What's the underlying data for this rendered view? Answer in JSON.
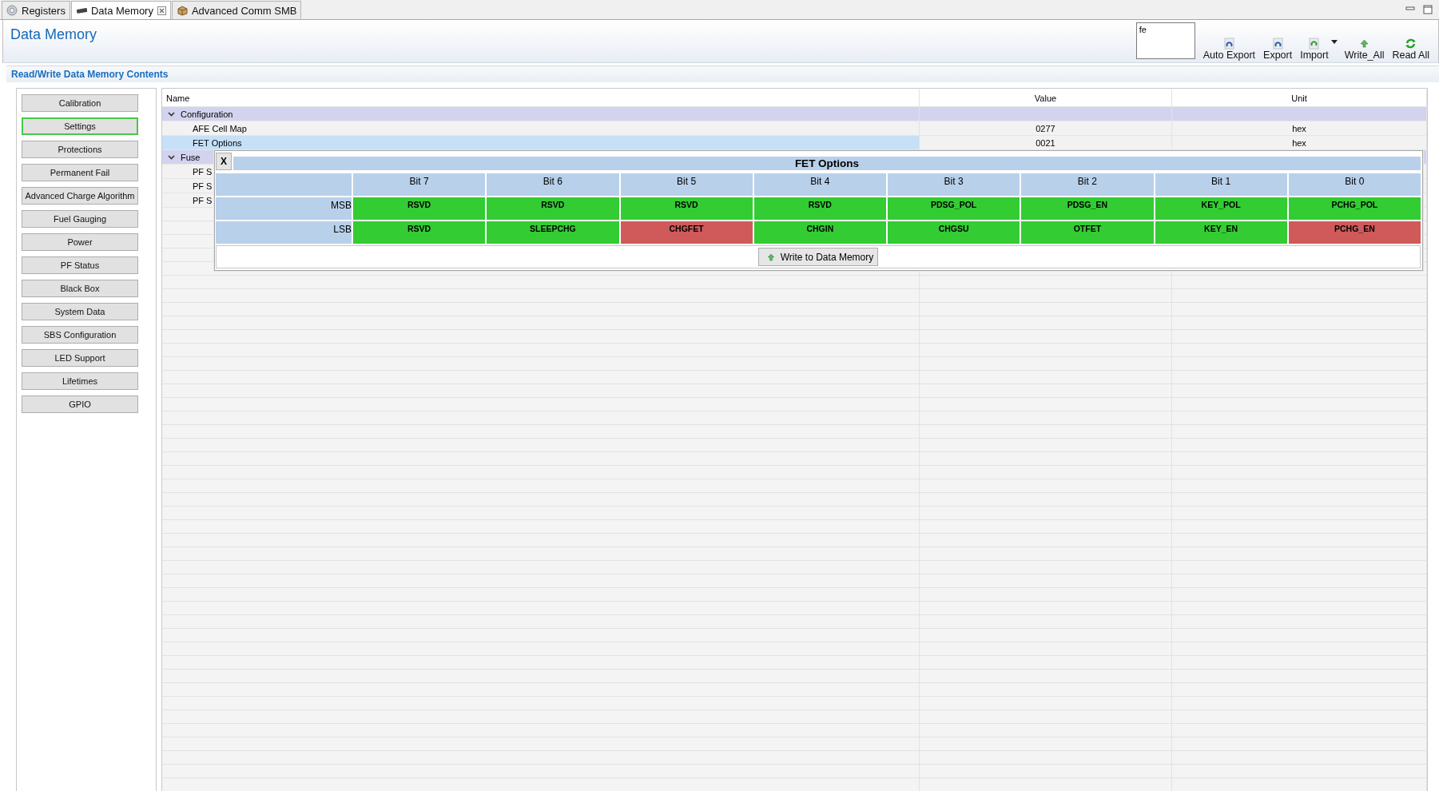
{
  "tabs": [
    {
      "label": "Registers",
      "selected": false
    },
    {
      "label": "Data Memory",
      "selected": true
    },
    {
      "label": "Advanced Comm SMB",
      "selected": false
    }
  ],
  "header": {
    "title": "Data Memory",
    "search": {
      "value": "fe"
    },
    "toolbar": [
      {
        "label": "Auto Export",
        "kind": "doc"
      },
      {
        "label": "Export",
        "kind": "doc"
      },
      {
        "label": "Import",
        "kind": "import"
      },
      {
        "label": "Write_All",
        "kind": "up"
      },
      {
        "label": "Read All",
        "kind": "refresh"
      }
    ]
  },
  "section_title": "Read/Write Data Memory Contents",
  "sidebar": {
    "items": [
      {
        "label": "Calibration",
        "selected": false
      },
      {
        "label": "Settings",
        "selected": true
      },
      {
        "label": "Protections",
        "selected": false
      },
      {
        "label": "Permanent Fail",
        "selected": false
      },
      {
        "label": "Advanced Charge Algorithm",
        "selected": false
      },
      {
        "label": "Fuel Gauging",
        "selected": false
      },
      {
        "label": "Power",
        "selected": false
      },
      {
        "label": "PF Status",
        "selected": false
      },
      {
        "label": "Black Box",
        "selected": false
      },
      {
        "label": "System Data",
        "selected": false
      },
      {
        "label": "SBS Configuration",
        "selected": false
      },
      {
        "label": "LED Support",
        "selected": false
      },
      {
        "label": "Lifetimes",
        "selected": false
      },
      {
        "label": "GPIO",
        "selected": false
      }
    ]
  },
  "table": {
    "columns": [
      "Name",
      "Value",
      "Unit"
    ],
    "rows": [
      {
        "name": "Configuration",
        "expanded": true,
        "children": [
          {
            "name": "AFE Cell Map",
            "value": "0277",
            "unit": "hex",
            "selected": false
          },
          {
            "name": "FET Options",
            "value": "0021",
            "unit": "hex",
            "selected": true
          }
        ]
      },
      {
        "name": "Fuse",
        "expanded": true,
        "children": [
          {
            "name": "PF S",
            "selected": false
          },
          {
            "name": "PF S",
            "selected": false
          },
          {
            "name": "PF S",
            "selected": false
          }
        ]
      }
    ]
  },
  "popup": {
    "close": "X",
    "title": "FET Options",
    "columns": [
      "Bit 7",
      "Bit 6",
      "Bit 5",
      "Bit 4",
      "Bit 3",
      "Bit 2",
      "Bit 1",
      "Bit 0"
    ],
    "rows": [
      {
        "label": "MSB",
        "bits": [
          {
            "name": "RSVD",
            "on": false
          },
          {
            "name": "RSVD",
            "on": false
          },
          {
            "name": "RSVD",
            "on": false
          },
          {
            "name": "RSVD",
            "on": false
          },
          {
            "name": "PDSG_POL",
            "on": false
          },
          {
            "name": "PDSG_EN",
            "on": false
          },
          {
            "name": "KEY_POL",
            "on": false
          },
          {
            "name": "PCHG_POL",
            "on": false
          }
        ]
      },
      {
        "label": "LSB",
        "bits": [
          {
            "name": "RSVD",
            "on": false
          },
          {
            "name": "SLEEPCHG",
            "on": false
          },
          {
            "name": "CHGFET",
            "on": true
          },
          {
            "name": "CHGIN",
            "on": false
          },
          {
            "name": "CHGSU",
            "on": false
          },
          {
            "name": "OTFET",
            "on": false
          },
          {
            "name": "KEY_EN",
            "on": false
          },
          {
            "name": "PCHG_EN",
            "on": true
          }
        ]
      }
    ],
    "button": "Write to Data Memory"
  }
}
